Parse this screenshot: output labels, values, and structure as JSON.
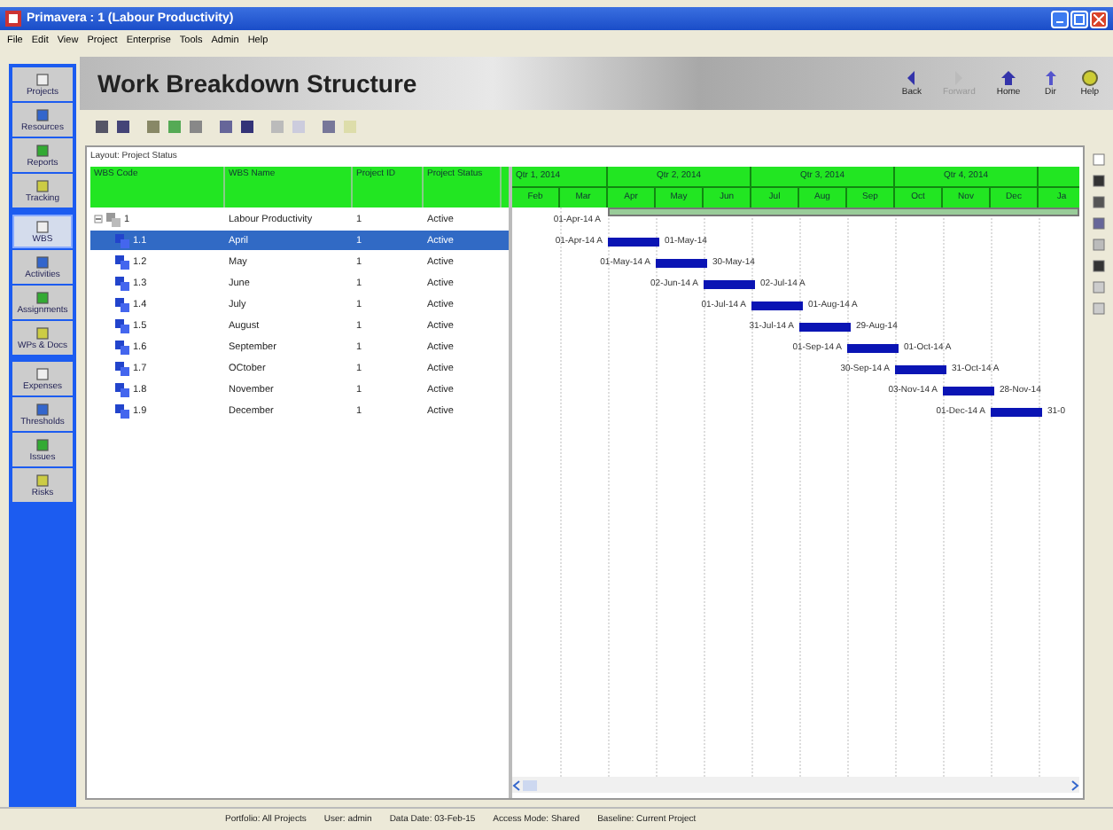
{
  "window": {
    "title": "Primavera : 1 (Labour Productivity)"
  },
  "menu": [
    "File",
    "Edit",
    "View",
    "Project",
    "Enterprise",
    "Tools",
    "Admin",
    "Help"
  ],
  "header": {
    "title": "Work Breakdown Structure",
    "nav": [
      {
        "label": "Back",
        "disabled": false,
        "kind": "back"
      },
      {
        "label": "Forward",
        "disabled": true,
        "kind": "forward"
      },
      {
        "label": "Home",
        "disabled": false,
        "kind": "home"
      },
      {
        "label": "Dir",
        "disabled": false,
        "kind": "dir"
      },
      {
        "label": "Help",
        "disabled": false,
        "kind": "help"
      }
    ]
  },
  "sidebar": [
    {
      "label": "Projects",
      "selected": false
    },
    {
      "label": "Resources",
      "selected": false
    },
    {
      "label": "Reports",
      "selected": false
    },
    {
      "label": "Tracking",
      "selected": false
    },
    {
      "label": "WBS",
      "selected": true
    },
    {
      "label": "Activities",
      "selected": false
    },
    {
      "label": "Assignments",
      "selected": false
    },
    {
      "label": "WPs & Docs",
      "selected": false
    },
    {
      "label": "Expenses",
      "selected": false
    },
    {
      "label": "Thresholds",
      "selected": false
    },
    {
      "label": "Issues",
      "selected": false
    },
    {
      "label": "Risks",
      "selected": false
    }
  ],
  "layout_label": "Layout: Project Status",
  "table": {
    "columns": [
      "WBS Code",
      "WBS Name",
      "Project ID",
      "Project Status"
    ],
    "rows": [
      {
        "code": "1",
        "name": "Labour Productivity",
        "project_id": "1",
        "status": "Active",
        "selected": false,
        "expanded": true,
        "children": [
          {
            "code": "1.1",
            "name": "April",
            "project_id": "1",
            "status": "Active",
            "selected": true
          },
          {
            "code": "1.2",
            "name": "May",
            "project_id": "1",
            "status": "Active",
            "selected": false
          },
          {
            "code": "1.3",
            "name": "June",
            "project_id": "1",
            "status": "Active",
            "selected": false
          },
          {
            "code": "1.4",
            "name": "July",
            "project_id": "1",
            "status": "Active",
            "selected": false
          },
          {
            "code": "1.5",
            "name": "August",
            "project_id": "1",
            "status": "Active",
            "selected": false
          },
          {
            "code": "1.6",
            "name": "September",
            "project_id": "1",
            "status": "Active",
            "selected": false
          },
          {
            "code": "1.7",
            "name": "OCtober",
            "project_id": "1",
            "status": "Active",
            "selected": false
          },
          {
            "code": "1.8",
            "name": "November",
            "project_id": "1",
            "status": "Active",
            "selected": false
          },
          {
            "code": "1.9",
            "name": "December",
            "project_id": "1",
            "status": "Active",
            "selected": false
          }
        ]
      }
    ]
  },
  "gantt": {
    "quarters": [
      "Qtr 1, 2014",
      "Qtr 2, 2014",
      "Qtr 3, 2014",
      "Qtr 4, 2014"
    ],
    "months": [
      "Feb",
      "Mar",
      "Apr",
      "May",
      "Jun",
      "Jul",
      "Aug",
      "Sep",
      "Oct",
      "Nov",
      "Dec",
      "Ja"
    ],
    "bars": [
      {
        "kind": "summary",
        "start": "01-Apr-14 A"
      },
      {
        "kind": "task",
        "start": "01-Apr-14 A",
        "finish": "01-May-14"
      },
      {
        "kind": "task",
        "start": "01-May-14 A",
        "finish": "30-May-14"
      },
      {
        "kind": "task",
        "start": "02-Jun-14 A",
        "finish": "02-Jul-14 A"
      },
      {
        "kind": "task",
        "start": "01-Jul-14 A",
        "finish": "01-Aug-14 A"
      },
      {
        "kind": "task",
        "start": "31-Jul-14 A",
        "finish": "29-Aug-14"
      },
      {
        "kind": "task",
        "start": "01-Sep-14 A",
        "finish": "01-Oct-14 A"
      },
      {
        "kind": "task",
        "start": "30-Sep-14 A",
        "finish": "31-Oct-14 A"
      },
      {
        "kind": "task",
        "start": "03-Nov-14 A",
        "finish": "28-Nov-14"
      },
      {
        "kind": "task",
        "start": "01-Dec-14 A",
        "finish": "31-0"
      }
    ]
  },
  "status_bar": [
    "Portfolio: All Projects",
    "User: admin",
    "Data Date: 03-Feb-15",
    "Access Mode: Shared",
    "Baseline: Current Project"
  ]
}
